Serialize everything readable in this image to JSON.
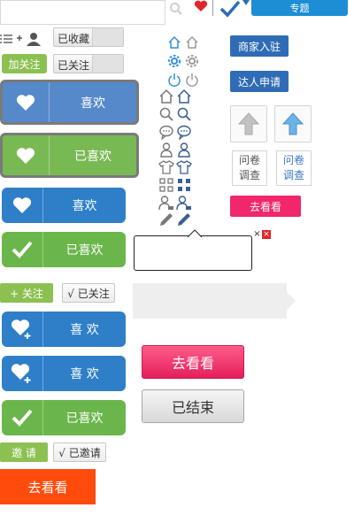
{
  "topbar": {
    "search_placeholder": "",
    "topic_label": "专题"
  },
  "left": {
    "favorited": "已收藏",
    "add_follow": "加关注",
    "followed": "已关注",
    "like": "喜欢",
    "liked": "已喜欢",
    "plus_follow": "+ 关注",
    "followed_check": "√ 已关注",
    "like_spaced": "喜 欢",
    "invite": "邀 请",
    "invited_check": "√ 已邀请",
    "go_see": "去看看"
  },
  "right": {
    "merchant_join": "商家入驻",
    "expert_apply": "达人申请",
    "survey_line1": "问卷",
    "survey_line2": "调查",
    "go_see": "去看看"
  },
  "middle": {
    "go_see": "去看看",
    "ended": "已结束",
    "close_x": "×"
  },
  "colors": {
    "blue": "#2e7fc8",
    "green": "#6ab64b",
    "pink": "#f2266a",
    "orange": "#ff4c0d",
    "navy": "#2f6cb5"
  }
}
